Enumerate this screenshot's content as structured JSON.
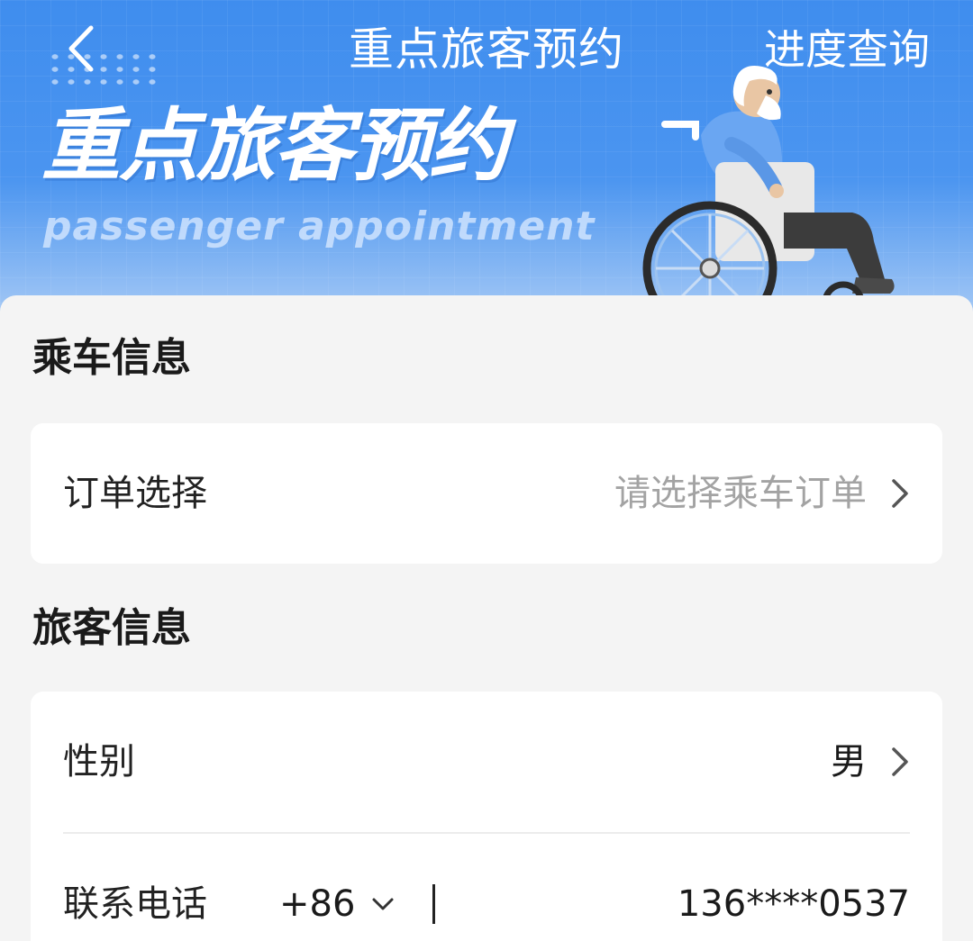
{
  "header": {
    "nav_title": "重点旅客预约",
    "action_label": "进度查询",
    "hero_title": "重点旅客预约",
    "hero_subtitle": "passenger appointment"
  },
  "ride_section": {
    "title": "乘车信息",
    "order_row": {
      "label": "订单选择",
      "placeholder": "请选择乘车订单"
    }
  },
  "passenger_section": {
    "title": "旅客信息",
    "gender_row": {
      "label": "性别",
      "value": "男"
    },
    "phone_row": {
      "label": "联系电话",
      "country_code": "+86",
      "value": "136****0537"
    }
  },
  "colors": {
    "banner": "#3f8dee",
    "page_bg": "#f4f4f4",
    "card_bg": "#ffffff",
    "placeholder": "#a3a3a3"
  },
  "icons": {
    "back": "chevron-left-icon",
    "row_arrow": "chevron-right-icon",
    "dropdown": "chevron-down-icon",
    "illustration": "wheelchair-passenger-illustration"
  }
}
